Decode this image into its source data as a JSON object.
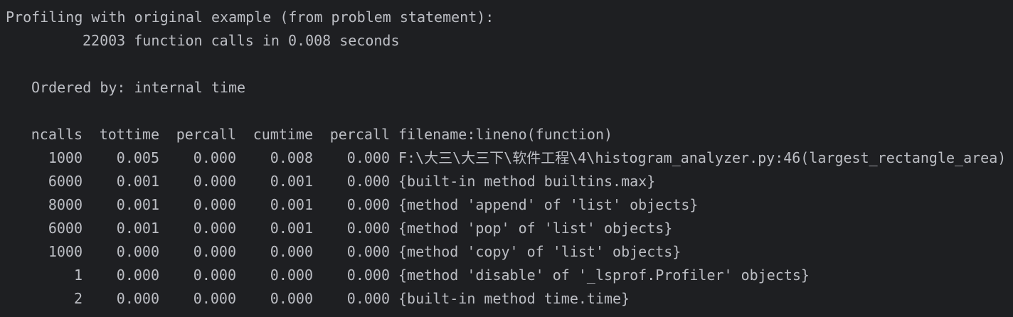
{
  "console": {
    "heading": "Profiling with original example (from problem statement):",
    "summary": "22003 function calls in 0.008 seconds",
    "ordered_by": "Ordered by: internal time"
  },
  "table": {
    "headers": {
      "ncalls": "ncalls",
      "tottime": "tottime",
      "percall1": "percall",
      "cumtime": "cumtime",
      "percall2": "percall",
      "function": "filename:lineno(function)"
    },
    "rows": [
      {
        "ncalls": "1000",
        "tottime": "0.005",
        "percall1": "0.000",
        "cumtime": "0.008",
        "percall2": "0.000",
        "function": "F:\\大三\\大三下\\软件工程\\4\\histogram_analyzer.py:46(largest_rectangle_area)"
      },
      {
        "ncalls": "6000",
        "tottime": "0.001",
        "percall1": "0.000",
        "cumtime": "0.001",
        "percall2": "0.000",
        "function": "{built-in method builtins.max}"
      },
      {
        "ncalls": "8000",
        "tottime": "0.001",
        "percall1": "0.000",
        "cumtime": "0.001",
        "percall2": "0.000",
        "function": "{method 'append' of 'list' objects}"
      },
      {
        "ncalls": "6000",
        "tottime": "0.001",
        "percall1": "0.000",
        "cumtime": "0.001",
        "percall2": "0.000",
        "function": "{method 'pop' of 'list' objects}"
      },
      {
        "ncalls": "1000",
        "tottime": "0.000",
        "percall1": "0.000",
        "cumtime": "0.000",
        "percall2": "0.000",
        "function": "{method 'copy' of 'list' objects}"
      },
      {
        "ncalls": "1",
        "tottime": "0.000",
        "percall1": "0.000",
        "cumtime": "0.000",
        "percall2": "0.000",
        "function": "{method 'disable' of '_lsprof.Profiler' objects}"
      },
      {
        "ncalls": "2",
        "tottime": "0.000",
        "percall1": "0.000",
        "cumtime": "0.000",
        "percall2": "0.000",
        "function": "{built-in method time.time}"
      }
    ]
  },
  "colors": {
    "background": "#1e1f22",
    "text": "#bcbec4"
  }
}
